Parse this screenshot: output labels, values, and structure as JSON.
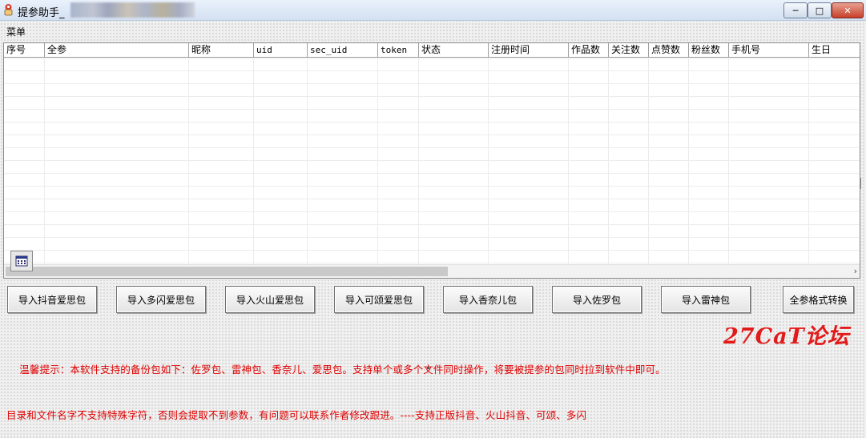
{
  "window": {
    "title": "提参助手_",
    "minimize_label": "─",
    "maximize_label": "□",
    "close_label": "✕"
  },
  "menu": {
    "items": [
      "菜单"
    ]
  },
  "table": {
    "columns": [
      "序号",
      "全参",
      "昵称",
      "uid",
      "sec_uid",
      "token",
      "状态",
      "注册时间",
      "作品数",
      "关注数",
      "点赞数",
      "粉丝数",
      "手机号",
      "生日"
    ],
    "rows": []
  },
  "scrollbar": {
    "right_arrow": "›"
  },
  "buttons": {
    "import_douyin": "导入抖音爱思包",
    "import_duoshan": "导入多闪爱思包",
    "import_huoshan": "导入火山爱思包",
    "import_kesong": "导入可颂爱思包",
    "import_xiangnaier": "导入香奈儿包",
    "import_zuoluo": "导入佐罗包",
    "import_leishen": "导入雷神包",
    "convert_format": "全参格式转换"
  },
  "notice": {
    "line1": "    温馨提示：本软件支持的备份包如下：佐罗包、雷神包、香奈儿、爱思包。支持单个或多个文件同时操作，将要被提参的包同时拉到软件中即可。",
    "line2": "目录和文件名字不支持特殊字符，否则会提取不到参数，有问题可以联系作者修改跟进。----支持正版抖音、火山抖音、可颂、多闪"
  },
  "watermark": "27CaT论坛",
  "colors": {
    "notice_text": "#e00000",
    "watermark": "#e31a1a"
  }
}
